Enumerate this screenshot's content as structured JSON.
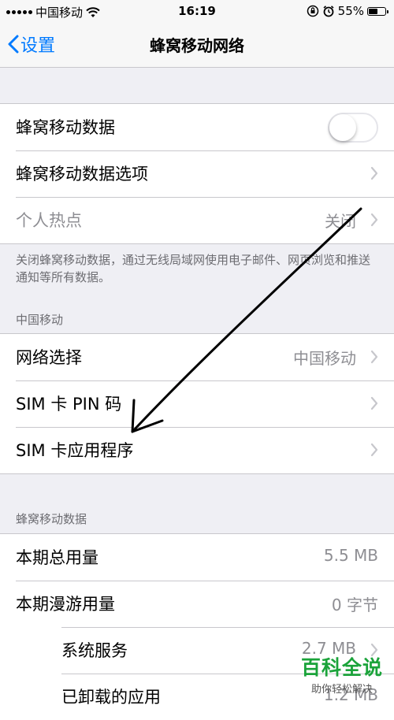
{
  "status_bar": {
    "carrier": "中国移动",
    "time": "16:19",
    "battery": "55%",
    "battery_level": 0.55
  },
  "nav": {
    "back_label": "设置",
    "title": "蜂窝移动网络"
  },
  "cellular_group": {
    "rows": [
      {
        "label": "蜂窝移动数据",
        "toggle_on": false
      },
      {
        "label": "蜂窝移动数据选项"
      },
      {
        "label": "个人热点",
        "value": "关闭",
        "disabled": true
      }
    ],
    "footnote": "关闭蜂窝移动数据，通过无线局域网使用电子邮件、网页浏览和推送通知等所有数据。"
  },
  "carrier_section": {
    "header": "中国移动",
    "rows": [
      {
        "label": "网络选择",
        "value": "中国移动"
      },
      {
        "label": "SIM 卡 PIN 码"
      },
      {
        "label": "SIM 卡应用程序"
      }
    ]
  },
  "data_section": {
    "header": "蜂窝移动数据",
    "rows": [
      {
        "label": "本期总用量",
        "value": "5.5 MB"
      },
      {
        "label": "本期漫游用量",
        "value": "0 字节"
      },
      {
        "label": "系统服务",
        "value": "2.7 MB"
      },
      {
        "label": "已卸载的应用",
        "value": "1.2 MB"
      }
    ]
  },
  "watermark": {
    "title": "百科全说",
    "subtitle": "助你轻松解决"
  },
  "colors": {
    "accent": "#007aff",
    "background": "#efeff4",
    "watermark": "#1aa33a"
  }
}
